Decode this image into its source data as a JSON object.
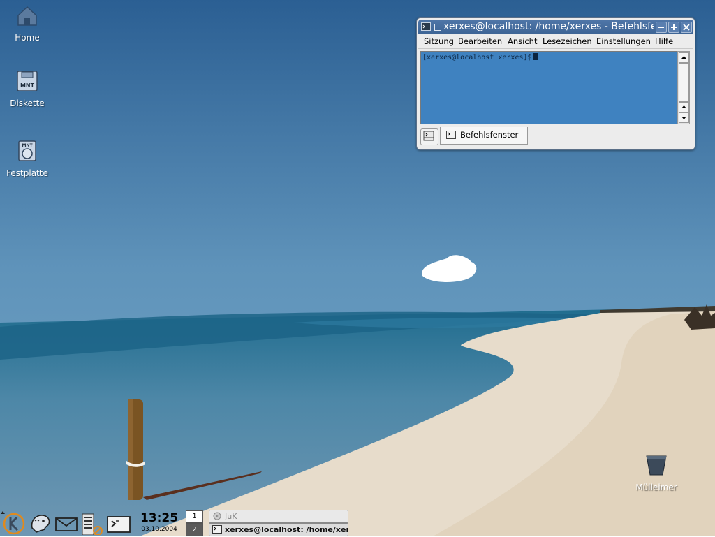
{
  "desktop": {
    "icons": [
      {
        "label": "Home",
        "icon": "home-icon"
      },
      {
        "label": "Diskette",
        "icon": "floppy-icon"
      },
      {
        "label": "Festplatte",
        "icon": "harddisk-icon"
      },
      {
        "label": "Mülleimer",
        "icon": "trash-icon"
      }
    ]
  },
  "window": {
    "title": "xerxes@localhost: /home/xerxes - Befehlsfenster - Konsole",
    "menu": [
      "Sitzung",
      "Bearbeiten",
      "Ansicht",
      "Lesezeichen",
      "Einstellungen",
      "Hilfe"
    ],
    "prompt": "[xerxes@localhost xerxes]$",
    "tab_label": "Befehlsfenster",
    "terminal_bg": "#3f82c0",
    "titlebar_color": "#4a72a3"
  },
  "taskbar": {
    "clock_time": "13:25",
    "clock_date": "03.10.2004",
    "pager": [
      "1",
      "2"
    ],
    "tasks": [
      {
        "label": "JuK",
        "active": false
      },
      {
        "label": "xerxes@localhost: /home/xerxes",
        "active": true
      }
    ],
    "launchers": [
      "k-menu-icon",
      "konqueror-icon",
      "mail-icon",
      "kwallet-icon",
      "terminal-icon"
    ]
  }
}
